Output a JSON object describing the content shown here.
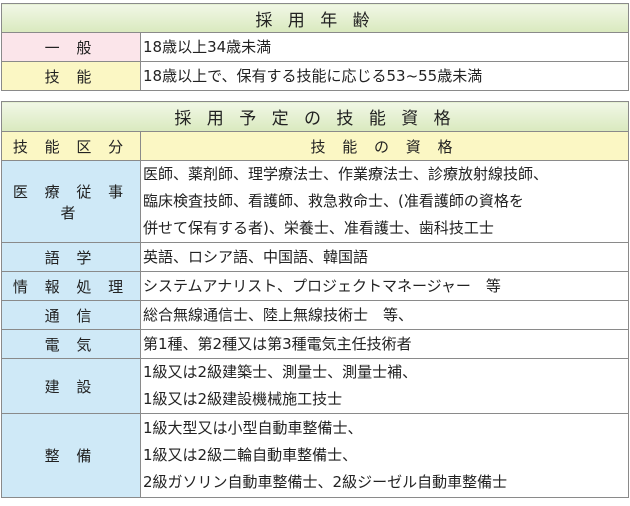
{
  "age_section": {
    "title": "採 用 年 齢",
    "rows": [
      {
        "label": "一 般",
        "value": "18歳以上34歳未満"
      },
      {
        "label": "技 能",
        "value": "18歳以上で、保有する技能に応じる53~55歳未満"
      }
    ]
  },
  "skill_section": {
    "title": "採 用 予 定 の 技 能 資 格",
    "header": {
      "category": "技 能 区 分",
      "qualification": "技 能 の 資 格"
    },
    "rows": [
      {
        "label": "医 療 従 事 者",
        "lines": [
          "医師、薬剤師、理学療法士、作業療法士、診療放射線技師、",
          "臨床検査技師、看護師、救急救命士、(准看護師の資格を",
          "併せて保有する者)、栄養士、准看護士、歯科技工士"
        ]
      },
      {
        "label": "語 学",
        "lines": [
          "英語、ロシア語、中国語、韓国語"
        ]
      },
      {
        "label": "情 報 処 理",
        "lines": [
          "システムアナリスト、プロジェクトマネージャー　等"
        ]
      },
      {
        "label": "通 信",
        "lines": [
          "総合無線通信士、陸上無線技術士　等、"
        ]
      },
      {
        "label": "電 気",
        "lines": [
          "第1種、第2種又は第3種電気主任技術者"
        ]
      },
      {
        "label": "建 設",
        "lines": [
          "1級又は2級建築士、測量士、測量士補、",
          "1級又は2級建設機械施工技士"
        ]
      },
      {
        "label": "整 備",
        "lines": [
          "1級大型又は小型自動車整備士、",
          "1級又は2級二輪自動車整備士、",
          "2級ガソリン自動車整備士、2級ジーゼル自動車整備士"
        ]
      }
    ]
  },
  "colors": {
    "title_bg": "#d9e9be",
    "pink": "#fbe5ea",
    "yellow": "#fbf7c4",
    "blue": "#cfe9f7",
    "border": "#8a8a8a"
  }
}
